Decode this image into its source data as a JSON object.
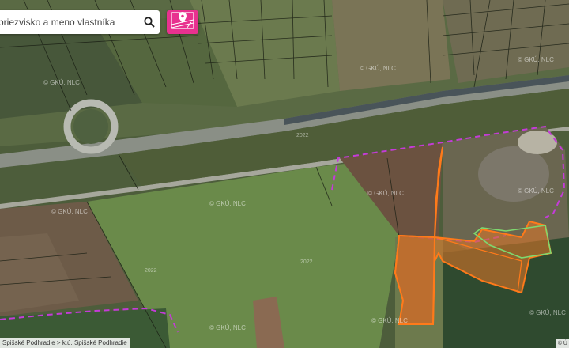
{
  "search": {
    "placeholder": "priezvisko a meno vlastníka"
  },
  "breadcrumb": "Spišské Podhradie > k.ú. Spišské Podhradie",
  "corner_text": "© Ú",
  "watermark": "© GKÚ, NLC",
  "year_label": "2022",
  "icons": {
    "search": "search-icon",
    "layer": "map-pin-parcel-icon"
  },
  "colors": {
    "accent": "#e8318f",
    "parcel_fill": "#d9742a",
    "parcel_stroke": "#ff7a1a",
    "cadastral_boundary": "#c43bd8",
    "parcel_lines": "#1a1f14",
    "green_outline": "#7ed86f"
  }
}
